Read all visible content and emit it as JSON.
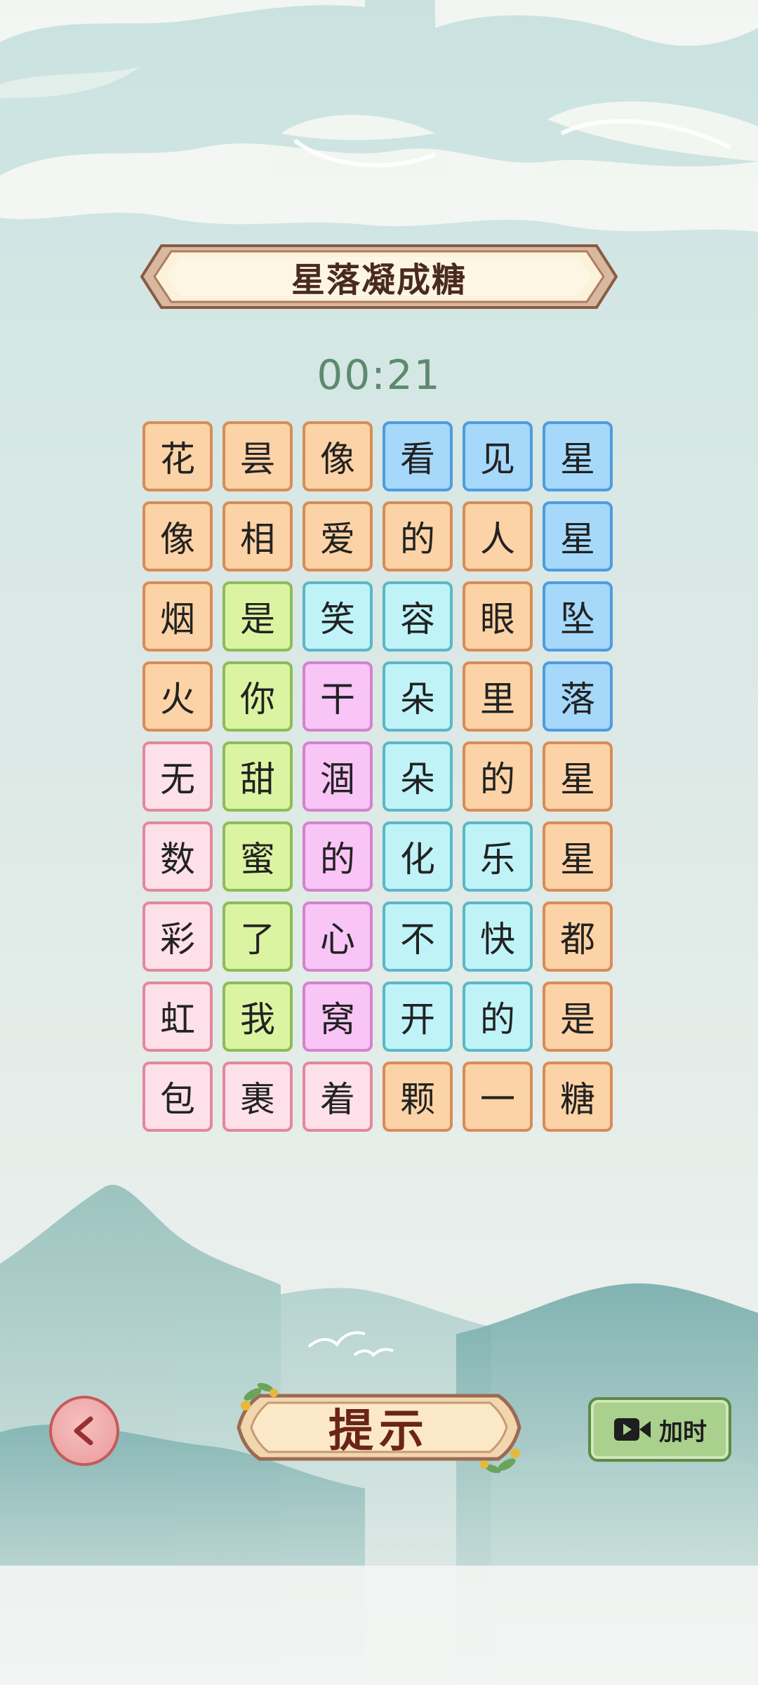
{
  "title": "星落凝成糖",
  "timer": "00:21",
  "grid": {
    "columns": 6,
    "rows": [
      [
        {
          "char": "花",
          "color": "orange"
        },
        {
          "char": "昙",
          "color": "orange"
        },
        {
          "char": "像",
          "color": "orange"
        },
        {
          "char": "看",
          "color": "blue"
        },
        {
          "char": "见",
          "color": "blue"
        },
        {
          "char": "星",
          "color": "blue"
        }
      ],
      [
        {
          "char": "像",
          "color": "orange"
        },
        {
          "char": "相",
          "color": "orange"
        },
        {
          "char": "爱",
          "color": "orange"
        },
        {
          "char": "的",
          "color": "orange"
        },
        {
          "char": "人",
          "color": "orange"
        },
        {
          "char": "星",
          "color": "blue"
        }
      ],
      [
        {
          "char": "烟",
          "color": "orange"
        },
        {
          "char": "是",
          "color": "green"
        },
        {
          "char": "笑",
          "color": "cyan"
        },
        {
          "char": "容",
          "color": "cyan"
        },
        {
          "char": "眼",
          "color": "orange"
        },
        {
          "char": "坠",
          "color": "blue"
        }
      ],
      [
        {
          "char": "火",
          "color": "orange"
        },
        {
          "char": "你",
          "color": "green"
        },
        {
          "char": "干",
          "color": "magenta"
        },
        {
          "char": "朵",
          "color": "cyan"
        },
        {
          "char": "里",
          "color": "orange"
        },
        {
          "char": "落",
          "color": "blue"
        }
      ],
      [
        {
          "char": "无",
          "color": "pink"
        },
        {
          "char": "甜",
          "color": "green"
        },
        {
          "char": "涸",
          "color": "magenta"
        },
        {
          "char": "朵",
          "color": "cyan"
        },
        {
          "char": "的",
          "color": "orange"
        },
        {
          "char": "星",
          "color": "orange"
        }
      ],
      [
        {
          "char": "数",
          "color": "pink"
        },
        {
          "char": "蜜",
          "color": "green"
        },
        {
          "char": "的",
          "color": "magenta"
        },
        {
          "char": "化",
          "color": "cyan"
        },
        {
          "char": "乐",
          "color": "cyan"
        },
        {
          "char": "星",
          "color": "orange"
        }
      ],
      [
        {
          "char": "彩",
          "color": "pink"
        },
        {
          "char": "了",
          "color": "green"
        },
        {
          "char": "心",
          "color": "magenta"
        },
        {
          "char": "不",
          "color": "cyan"
        },
        {
          "char": "快",
          "color": "cyan"
        },
        {
          "char": "都",
          "color": "orange"
        }
      ],
      [
        {
          "char": "虹",
          "color": "pink"
        },
        {
          "char": "我",
          "color": "green"
        },
        {
          "char": "窝",
          "color": "magenta"
        },
        {
          "char": "开",
          "color": "cyan"
        },
        {
          "char": "的",
          "color": "cyan"
        },
        {
          "char": "是",
          "color": "orange"
        }
      ],
      [
        {
          "char": "包",
          "color": "pink"
        },
        {
          "char": "裹",
          "color": "pink"
        },
        {
          "char": "着",
          "color": "pink"
        },
        {
          "char": "颗",
          "color": "orange"
        },
        {
          "char": "一",
          "color": "orange"
        },
        {
          "char": "糖",
          "color": "orange"
        }
      ]
    ]
  },
  "buttons": {
    "back_icon": "chevron-left-icon",
    "hint_label": "提示",
    "add_time_label": "加时",
    "add_time_icon": "video-camera-icon"
  },
  "colors": {
    "orange": "#fcd3a6",
    "blue": "#a6d8fa",
    "green": "#dbf4a2",
    "cyan": "#bff3f7",
    "magenta": "#f9c4f6",
    "pink": "#fde0ea",
    "timer": "#5d8a6d",
    "title_text": "#4a2a1e"
  }
}
